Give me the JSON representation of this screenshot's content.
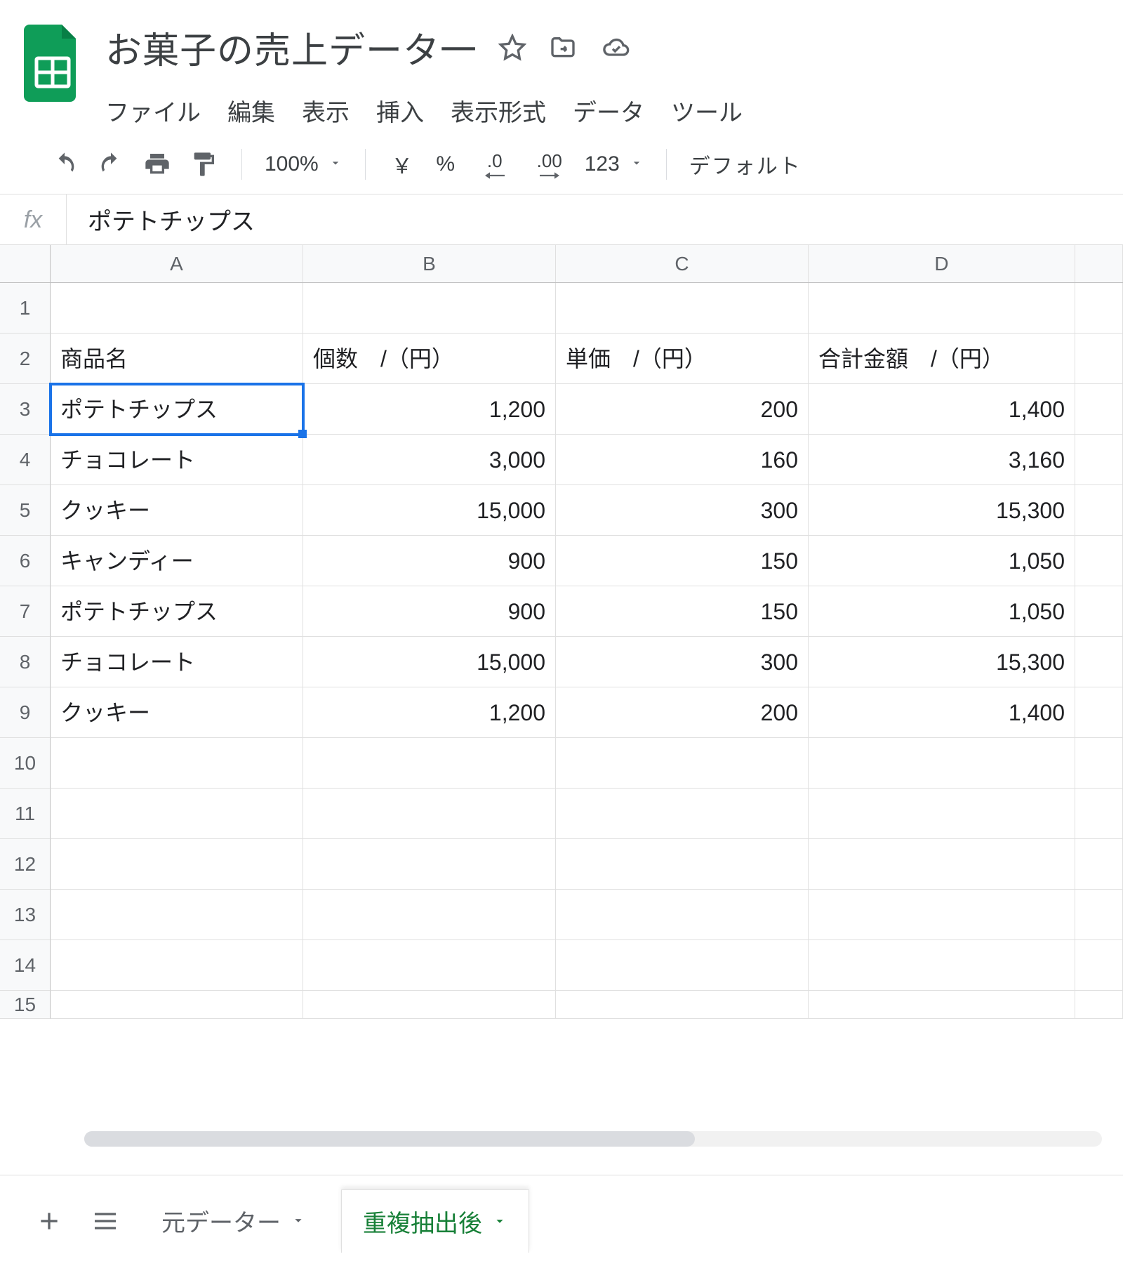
{
  "header": {
    "title": "お菓子の売上データ一"
  },
  "menubar": {
    "items": [
      "ファイル",
      "編集",
      "表示",
      "挿入",
      "表示形式",
      "データ",
      "ツール"
    ]
  },
  "toolbar": {
    "zoom": "100%",
    "currency": "￥",
    "percent": "%",
    "dec_dec": ".0",
    "inc_dec": ".00",
    "number_format": "123",
    "font": "デフォルト"
  },
  "formula": {
    "label": "fx",
    "value": "ポテトチップス"
  },
  "columns": [
    "A",
    "B",
    "C",
    "D"
  ],
  "row_count": 15,
  "selected_cell": "A3",
  "sheet_headers": {
    "A": "商品名",
    "B": "個数　/（円）",
    "C": "単価　/（円）",
    "D": "合計金額　/（円）"
  },
  "sheet_data": [
    {
      "A": "ポテトチップス",
      "B": "1,200",
      "C": "200",
      "D": "1,400"
    },
    {
      "A": "チョコレート",
      "B": "3,000",
      "C": "160",
      "D": "3,160"
    },
    {
      "A": "クッキー",
      "B": "15,000",
      "C": "300",
      "D": "15,300"
    },
    {
      "A": "キャンディー",
      "B": "900",
      "C": "150",
      "D": "1,050"
    },
    {
      "A": "ポテトチップス",
      "B": "900",
      "C": "150",
      "D": "1,050"
    },
    {
      "A": "チョコレート",
      "B": "15,000",
      "C": "300",
      "D": "15,300"
    },
    {
      "A": "クッキー",
      "B": "1,200",
      "C": "200",
      "D": "1,400"
    }
  ],
  "sheets": {
    "tabs": [
      {
        "label": "元データー",
        "active": false
      },
      {
        "label": "重複抽出後",
        "active": true
      }
    ]
  }
}
